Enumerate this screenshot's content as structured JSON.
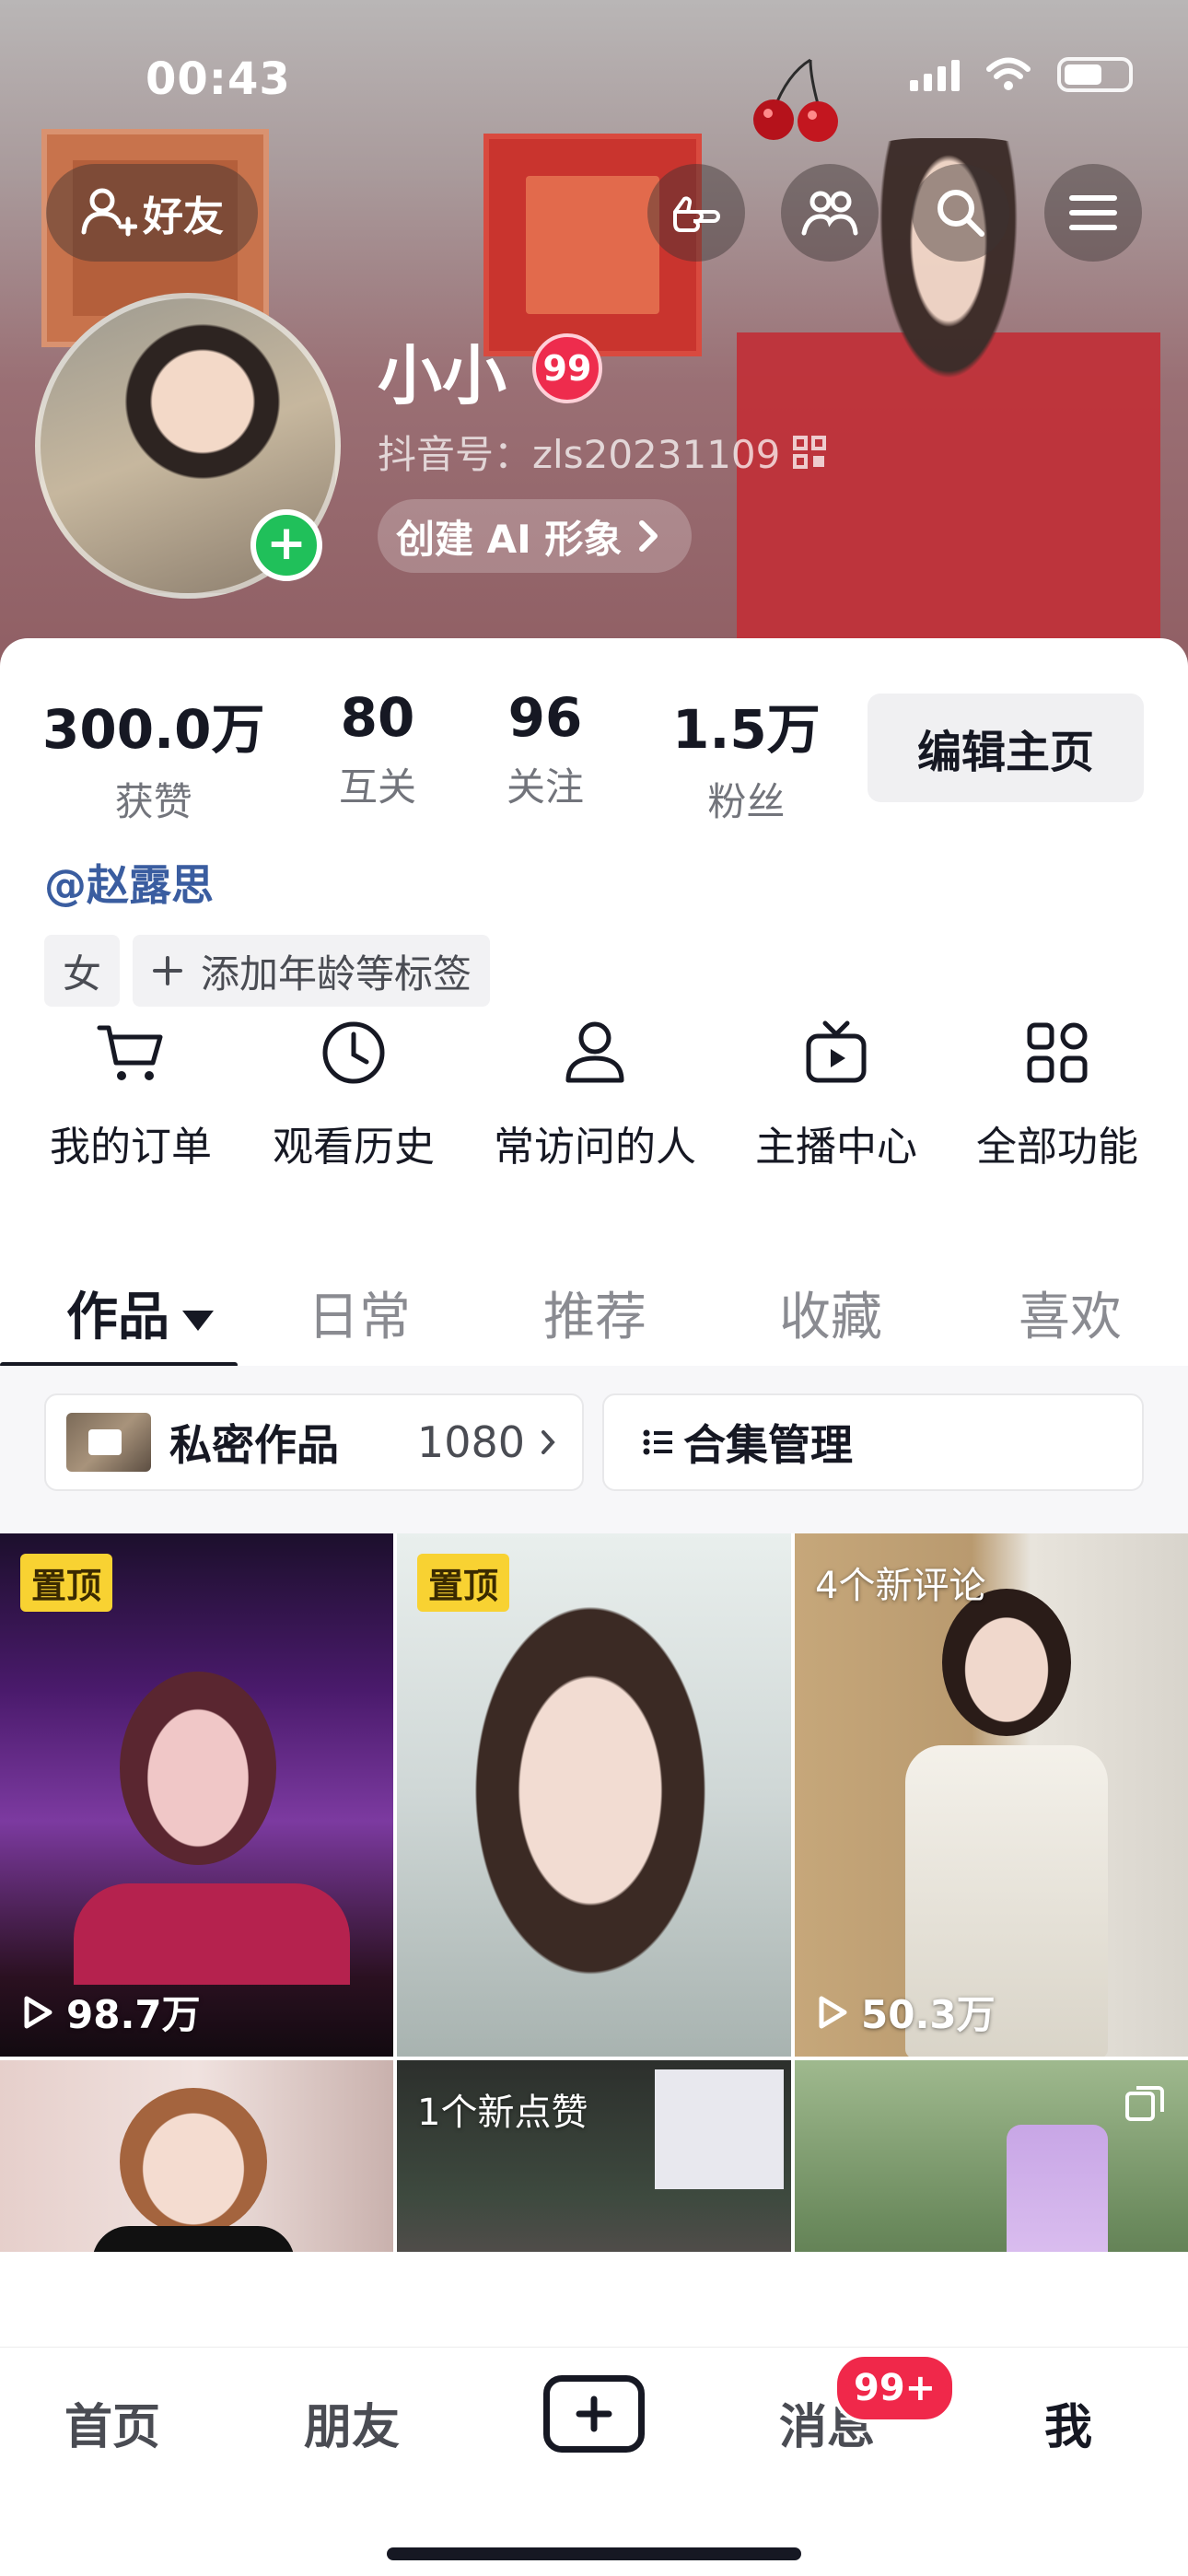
{
  "status_bar": {
    "time": "00:43"
  },
  "header": {
    "add_friend_label": "好友",
    "nickname": "小小",
    "level": "99",
    "douyin_id": "抖音号：zls20231109",
    "ai_button_label": "创建 AI 形象"
  },
  "stats": [
    {
      "value": "300.0万",
      "label": "获赞"
    },
    {
      "value": "80",
      "label": "互关"
    },
    {
      "value": "96",
      "label": "关注"
    },
    {
      "value": "1.5万",
      "label": "粉丝"
    }
  ],
  "edit_profile_label": "编辑主页",
  "mention": "@赵露思",
  "tags": {
    "gender": "女",
    "add_tags": "添加年龄等标签"
  },
  "shortcuts": [
    {
      "label": "我的订单",
      "icon": "cart-icon"
    },
    {
      "label": "观看历史",
      "icon": "clock-icon"
    },
    {
      "label": "常访问的人",
      "icon": "person-icon"
    },
    {
      "label": "主播中心",
      "icon": "tv-icon"
    },
    {
      "label": "全部功能",
      "icon": "grid-icon"
    }
  ],
  "tabs": [
    {
      "label": "作品"
    },
    {
      "label": "日常"
    },
    {
      "label": "推荐"
    },
    {
      "label": "收藏"
    },
    {
      "label": "喜欢"
    }
  ],
  "private_works": {
    "label": "私密作品",
    "count": "1080"
  },
  "collection_manage_label": "合集管理",
  "videos": [
    {
      "pin": "置顶",
      "plays": "98.7万"
    },
    {
      "pin": "置顶"
    },
    {
      "overlay": "4个新评论",
      "plays": "50.3万"
    },
    {},
    {
      "overlay": "1个新点赞"
    },
    {}
  ],
  "bottom_nav": {
    "home": "首页",
    "friends": "朋友",
    "messages": "消息",
    "messages_badge": "99+",
    "me": "我"
  }
}
